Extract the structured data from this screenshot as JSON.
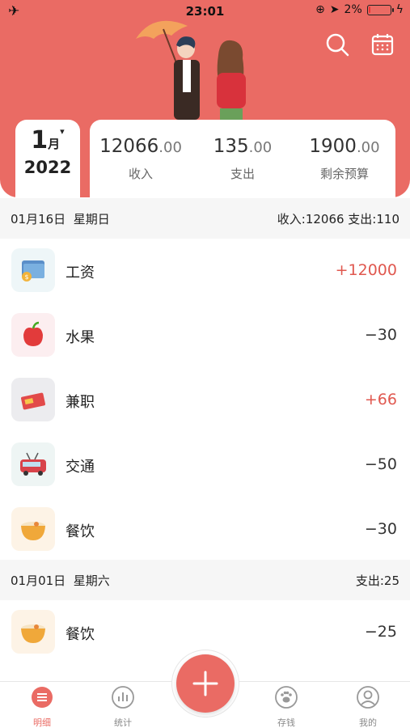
{
  "status_bar": {
    "time": "23:01",
    "battery": "2%",
    "battery_level": 0.02
  },
  "header": {
    "month": "1",
    "month_unit": "月",
    "year": "2022",
    "summary": [
      {
        "int": "12066",
        "dec": ".00",
        "label": "收入"
      },
      {
        "int": "135",
        "dec": ".00",
        "label": "支出"
      },
      {
        "int": "1900",
        "dec": ".00",
        "label": "剩余预算"
      }
    ],
    "icons": [
      "search-icon",
      "calendar-icon"
    ]
  },
  "days": [
    {
      "date": "01月16日",
      "weekday": "星期日",
      "totals": "收入:12066  支出:110",
      "items": [
        {
          "name": "工资",
          "amount": "+12000",
          "icon": "wallet-icon",
          "positive": true
        },
        {
          "name": "水果",
          "amount": "−30",
          "icon": "apple-icon",
          "positive": false
        },
        {
          "name": "兼职",
          "amount": "+66",
          "icon": "cash-icon",
          "positive": true
        },
        {
          "name": "交通",
          "amount": "−50",
          "icon": "bus-icon",
          "positive": false
        },
        {
          "name": "餐饮",
          "amount": "−30",
          "icon": "noodle-bowl-icon",
          "positive": false
        }
      ]
    },
    {
      "date": "01月01日",
      "weekday": "星期六",
      "totals": "支出:25",
      "items": [
        {
          "name": "餐饮",
          "amount": "−25",
          "icon": "noodle-bowl-icon",
          "positive": false
        }
      ]
    }
  ],
  "tabbar": {
    "tabs": [
      {
        "label": "明细",
        "icon": "list-icon",
        "active": true
      },
      {
        "label": "统计",
        "icon": "chart-icon",
        "active": false
      },
      {
        "label": "存钱",
        "icon": "paw-icon",
        "active": false
      },
      {
        "label": "我的",
        "icon": "user-icon",
        "active": false
      }
    ],
    "fab_icon": "plus-icon"
  },
  "colors": {
    "accent": "#ea6b64",
    "positive": "#e0584f"
  }
}
